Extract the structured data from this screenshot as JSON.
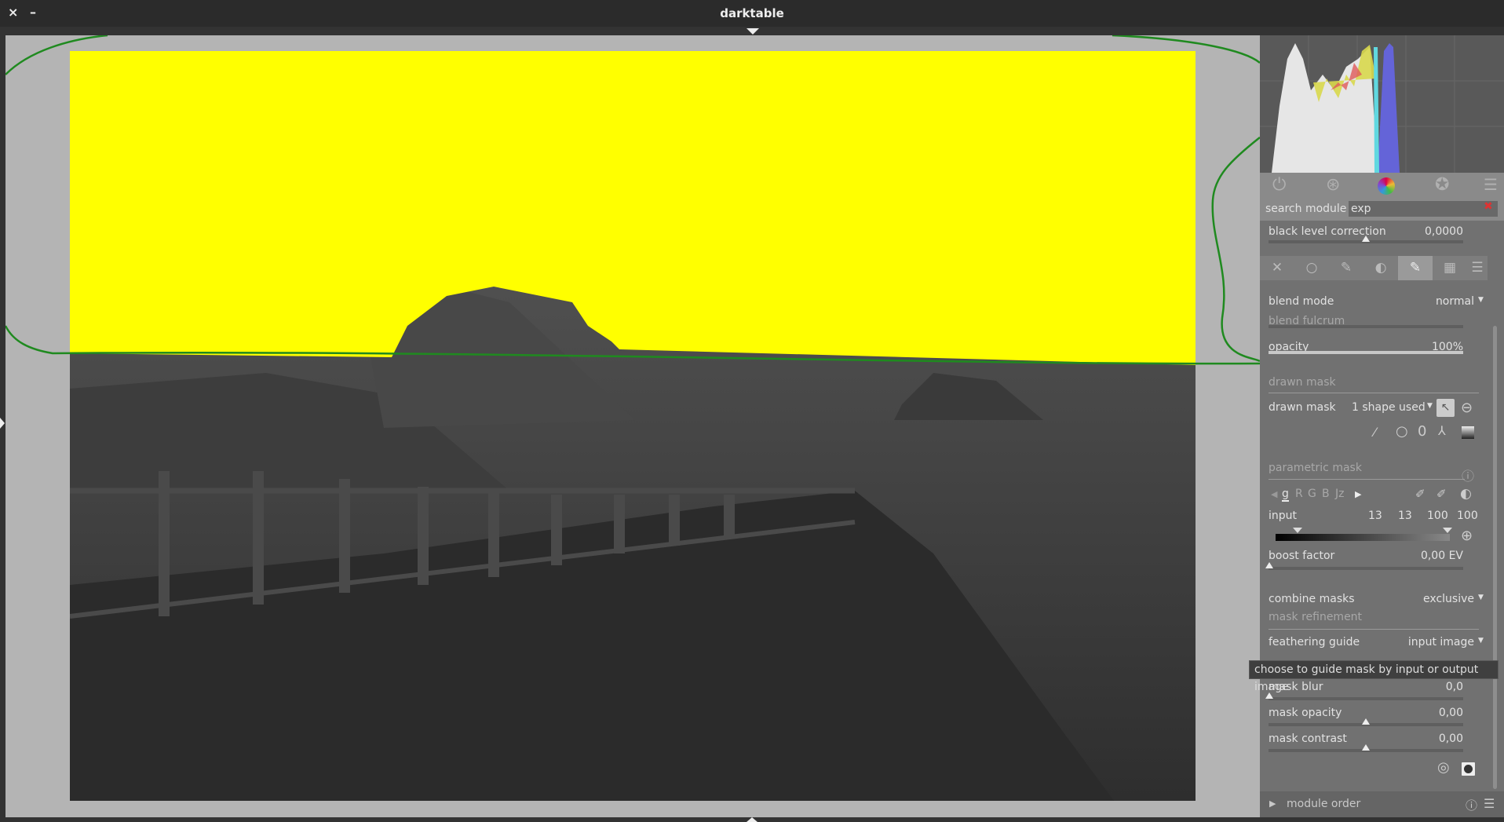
{
  "window": {
    "title": "darktable",
    "close": "×",
    "minimize": "–"
  },
  "search": {
    "label": "search module",
    "value": "exp"
  },
  "module": {
    "black_level": {
      "label": "black level correction",
      "value": "0,0000"
    }
  },
  "blend": {
    "blend_mode": {
      "label": "blend mode",
      "value": "normal"
    },
    "blend_fulcrum": {
      "label": "blend fulcrum"
    },
    "opacity": {
      "label": "opacity",
      "value": "100%",
      "fraction": 1.0
    },
    "drawn_mask_header": "drawn mask",
    "drawn_mask": {
      "label": "drawn mask",
      "value": "1 shape used"
    },
    "parametric_header": "parametric mask",
    "channels": [
      "g",
      "R",
      "G",
      "B",
      "Jz"
    ],
    "input": {
      "label": "input",
      "values": [
        "13",
        "13",
        "100",
        "100"
      ]
    },
    "boost": {
      "label": "boost factor",
      "value": "0,00 EV"
    },
    "combine": {
      "label": "combine masks",
      "value": "exclusive"
    },
    "refinement_header": "mask refinement",
    "feathering": {
      "label": "feathering guide",
      "value": "input image"
    },
    "mask_blur": {
      "label": "mask blur",
      "value": "0,0"
    },
    "mask_opacity": {
      "label": "mask opacity",
      "value": "0,00"
    },
    "mask_contrast": {
      "label": "mask contrast",
      "value": "0,00"
    }
  },
  "tooltip": "choose to guide mask by input or output image",
  "module_order": {
    "label": "module order"
  },
  "colors": {
    "mask": "#ffff00",
    "shape": "#1f8a1f"
  }
}
